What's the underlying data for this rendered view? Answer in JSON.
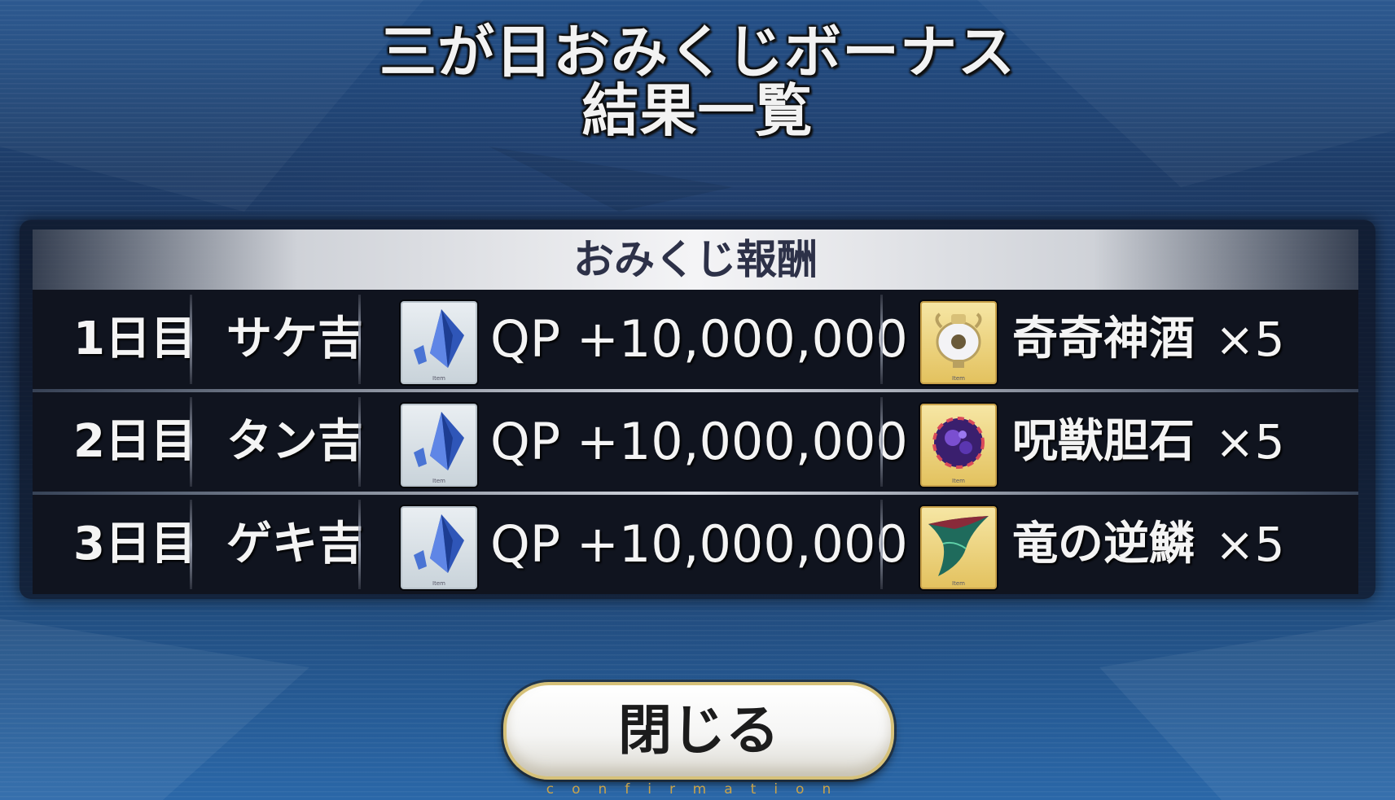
{
  "title": {
    "line1": "三が日おみくじボーナス",
    "line2": "結果一覧"
  },
  "panel": {
    "header": "おみくじ報酬",
    "rows": [
      {
        "day": "1日目",
        "fortune": "サケ吉",
        "qp_icon": "qp-crystal-icon",
        "qp_text": "QP +10,000,000",
        "item_icon": "divine-wine-icon",
        "item_name": "奇奇神酒",
        "item_qty": "×5"
      },
      {
        "day": "2日目",
        "fortune": "タン吉",
        "qp_icon": "qp-crystal-icon",
        "qp_text": "QP +10,000,000",
        "item_icon": "cursed-beast-gallstone-icon",
        "item_name": "呪獣胆石",
        "item_qty": "×5"
      },
      {
        "day": "3日目",
        "fortune": "ゲキ吉",
        "qp_icon": "qp-crystal-icon",
        "qp_text": "QP +10,000,000",
        "item_icon": "dragon-reverse-scale-icon",
        "item_name": "竜の逆鱗",
        "item_qty": "×5"
      }
    ]
  },
  "icon_tag": "Item",
  "close_button": {
    "label": "閉じる",
    "sublabel": "confirmation"
  },
  "colors": {
    "background": "#1d3b66",
    "accent_gold": "#c9a34a",
    "header_text": "#2d3148"
  }
}
